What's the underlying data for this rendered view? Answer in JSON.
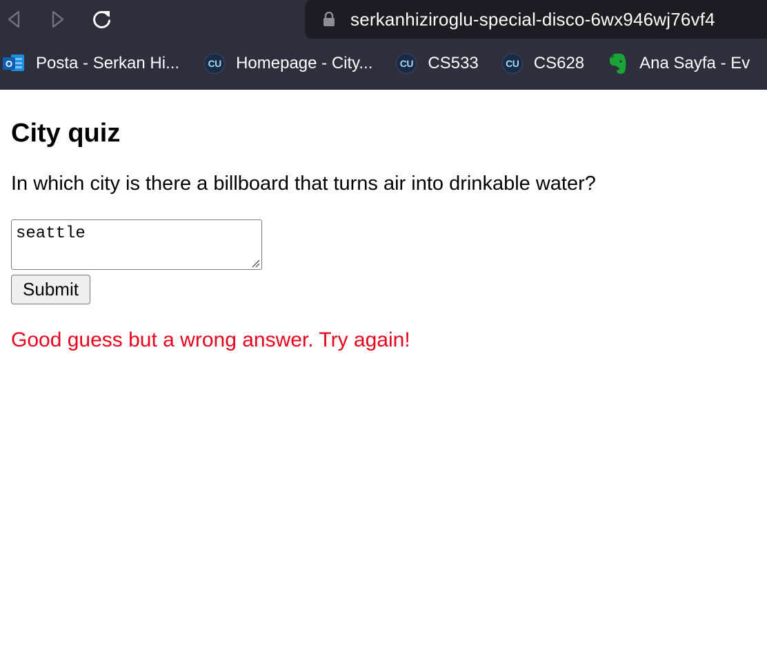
{
  "browser": {
    "url": "serkanhiziroglu-special-disco-6wx946wj76vf4",
    "bookmarks": [
      {
        "label": "Posta - Serkan Hi...",
        "icon": "outlook-icon"
      },
      {
        "label": "Homepage - City...",
        "icon": "cu-icon"
      },
      {
        "label": "CS533",
        "icon": "cu-icon"
      },
      {
        "label": "CS628",
        "icon": "cu-icon"
      },
      {
        "label": "Ana Sayfa - Ev",
        "icon": "evernote-icon"
      }
    ],
    "cu_badge_text": "CU",
    "outlook_badge_text": "O",
    "colors": {
      "chrome_bg": "#2d2f3d",
      "urlbar_bg": "#1c1c22"
    }
  },
  "page": {
    "title": "City quiz",
    "question": "In which city is there a billboard that turns air into drinkable water?",
    "answer_value": "seattle",
    "submit_label": "Submit",
    "feedback": "Good guess but a wrong answer. Try again!",
    "colors": {
      "feedback": "#e8001c"
    }
  }
}
